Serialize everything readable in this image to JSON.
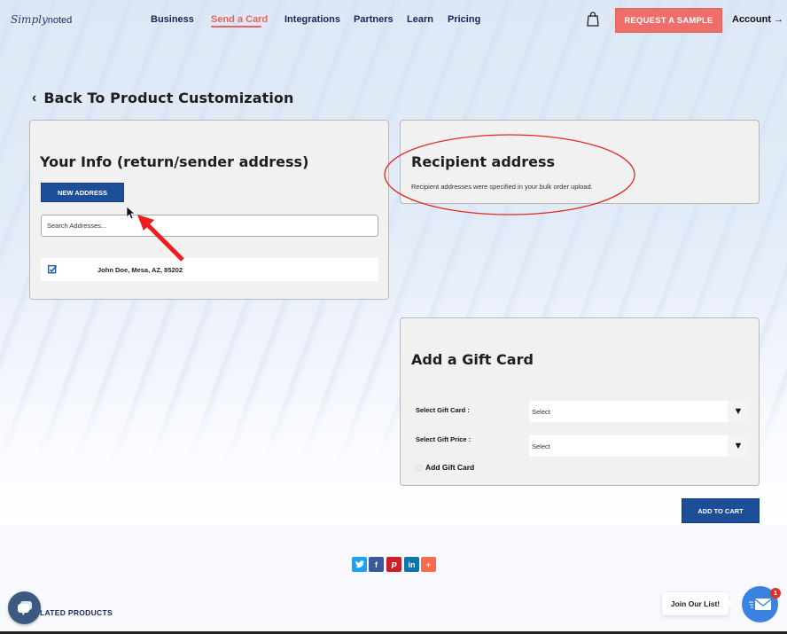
{
  "header": {
    "logo": {
      "script": "Simply",
      "text": "noted"
    },
    "nav": [
      {
        "label": "Business",
        "active": false
      },
      {
        "label": "Send a Card",
        "active": true
      },
      {
        "label": "Integrations",
        "active": false
      },
      {
        "label": "Partners",
        "active": false
      },
      {
        "label": "Learn",
        "active": false
      },
      {
        "label": "Pricing",
        "active": false
      }
    ],
    "cart_icon": "shopping-bag-icon",
    "request_sample_label": "REQUEST A SAMPLE",
    "account_label": "Account →"
  },
  "back_link": {
    "icon": "chevron-left-icon",
    "label": "Back To Product Customization"
  },
  "sender": {
    "title": "Your Info (return/sender address)",
    "new_address_label": "NEW ADDRESS",
    "search_placeholder": "Search Addresses...",
    "addresses": [
      {
        "checked": true,
        "text": "John Doe, Mesa, AZ, 85202"
      }
    ]
  },
  "recipient": {
    "title": "Recipient address",
    "message": "Recipient addresses were specified in your bulk order upload."
  },
  "gift_card": {
    "title": "Add a Gift Card",
    "select_card_label": "Select Gift Card :",
    "select_card_value": "Select",
    "select_price_label": "Select Gift Price :",
    "select_price_value": "Select",
    "add_checkbox_label": "Add Gift Card",
    "add_checkbox_checked": false
  },
  "add_to_cart_label": "ADD TO CART",
  "share": [
    {
      "network": "twitter",
      "glyph": "t",
      "color": "#1da1f2"
    },
    {
      "network": "facebook",
      "glyph": "f",
      "color": "#3b5998"
    },
    {
      "network": "pinterest",
      "glyph": "P",
      "color": "#cb2027"
    },
    {
      "network": "linkedin",
      "glyph": "in",
      "color": "#0e76a8"
    },
    {
      "network": "more",
      "glyph": "+",
      "color": "#f8694d"
    }
  ],
  "related_products_label": "LATED PRODUCTS",
  "join_list_label": "Join Our List!",
  "mail_badge_count": "1",
  "colors": {
    "brand_blue": "#1c4f97",
    "accent_coral": "#ee6e6b",
    "nav_navy": "#17265a",
    "annotation_red": "#e02b20"
  }
}
